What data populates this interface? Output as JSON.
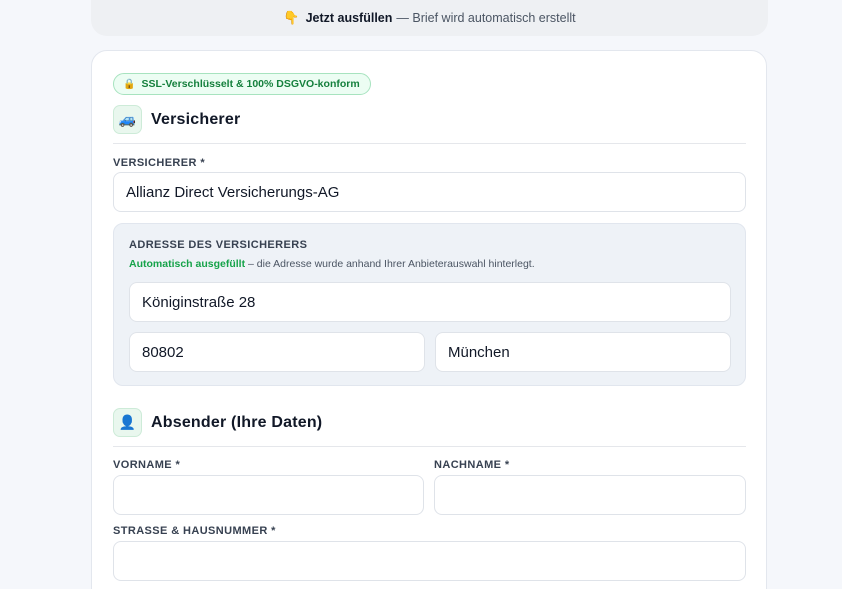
{
  "banner": {
    "icon": "pointing-down-hand-icon",
    "strong": "Jetzt ausfüllen",
    "rest": "— Brief wird automatisch erstellt"
  },
  "ssl_badge": {
    "icon": "lock-icon",
    "text": "SSL-Verschlüsselt & 100% DSGVO-konform"
  },
  "sections": {
    "insurer": {
      "icon": "car-icon",
      "title": "Versicherer",
      "field_label": "Versicherer *",
      "field_value": "Allianz Direct Versicherungs-AG",
      "address": {
        "label": "Adresse des Versicherers",
        "note_strong": "Automatisch ausgefüllt",
        "note_rest": " – die Adresse wurde anhand Ihrer Anbieterauswahl hinterlegt.",
        "street": "Königinstraße 28",
        "zip": "80802",
        "city": "München"
      }
    },
    "sender": {
      "icon": "person-icon",
      "title": "Absender (Ihre Daten)",
      "firstname_label": "Vorname *",
      "lastname_label": "Nachname *",
      "street_label": "Strasse & Hausnummer *",
      "firstname_value": "",
      "lastname_value": "",
      "street_value": ""
    }
  },
  "colors": {
    "accent_green": "#16a34a",
    "badge_bg": "#ecfdf3",
    "panel_bg": "#eef2f7"
  }
}
